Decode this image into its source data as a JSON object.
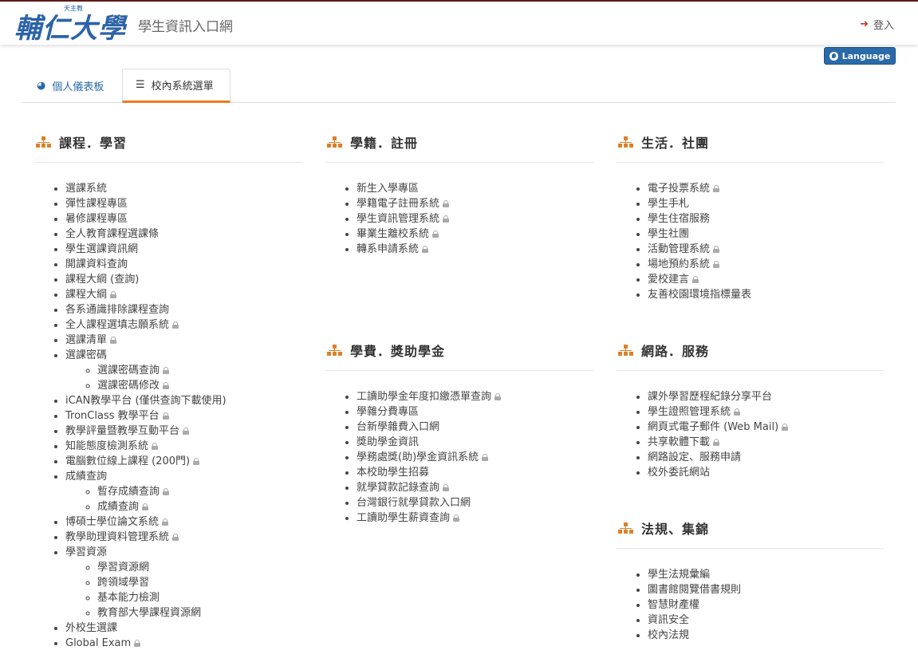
{
  "header": {
    "logo_text": "輔仁大學",
    "logo_small": "天主教",
    "site_title": "學生資訊入口網",
    "login_label": "登入",
    "language_label": "Language"
  },
  "tabs": [
    {
      "label": "個人儀表板",
      "icon": "dashboard-icon",
      "active": false
    },
    {
      "label": "校內系統選單",
      "icon": "list-icon",
      "active": true
    }
  ],
  "colors": {
    "accent": "#2a6aa8",
    "section_icon": "#d9822b",
    "active_tab_border": "#e67e22",
    "lock": "#aaaaaa"
  },
  "sections": {
    "course": {
      "title": "課程．學習",
      "items": [
        {
          "label": "選課系統",
          "lock": false
        },
        {
          "label": "彈性課程專區",
          "lock": false
        },
        {
          "label": "暑修課程專區",
          "lock": false
        },
        {
          "label": "全人教育課程選課條",
          "lock": false
        },
        {
          "label": "學生選課資訊網",
          "lock": false
        },
        {
          "label": "開課資料查詢",
          "lock": false
        },
        {
          "label": "課程大綱 (查詢)",
          "lock": false
        },
        {
          "label": "課程大綱",
          "lock": true
        },
        {
          "label": "各系通識排除課程查詢",
          "lock": false
        },
        {
          "label": "全人課程選填志願系統",
          "lock": true
        },
        {
          "label": "選課清單",
          "lock": true
        },
        {
          "label": "選課密碼",
          "lock": false,
          "children": [
            {
              "label": "選課密碼查詢",
              "lock": true
            },
            {
              "label": "選課密碼修改",
              "lock": true
            }
          ]
        },
        {
          "label": "iCAN教學平台 (僅供查詢下載使用)",
          "lock": false
        },
        {
          "label": "TronClass 教學平台",
          "lock": true
        },
        {
          "label": "教學評量暨教學互動平台",
          "lock": true
        },
        {
          "label": "知能態度檢測系統",
          "lock": true
        },
        {
          "label": "電腦數位線上課程 (200門)",
          "lock": true
        },
        {
          "label": "成績查詢",
          "lock": false,
          "children": [
            {
              "label": "暫存成績查詢",
              "lock": true
            },
            {
              "label": "成績查詢",
              "lock": true
            }
          ]
        },
        {
          "label": "博碩士學位論文系統",
          "lock": true
        },
        {
          "label": "教學助理資料管理系統",
          "lock": true
        },
        {
          "label": "學習資源",
          "lock": false,
          "children": [
            {
              "label": "學習資源網",
              "lock": false
            },
            {
              "label": "跨領域學習",
              "lock": false
            },
            {
              "label": "基本能力檢測",
              "lock": false
            },
            {
              "label": "教育部大學課程資源網",
              "lock": false
            }
          ]
        },
        {
          "label": "外校生選課",
          "lock": false
        },
        {
          "label": "Global Exam",
          "lock": true
        }
      ]
    },
    "registry": {
      "title": "學籍．註冊",
      "items": [
        {
          "label": "新生入學專區",
          "lock": false
        },
        {
          "label": "學籍電子註冊系統",
          "lock": true
        },
        {
          "label": "學生資訊管理系統",
          "lock": true
        },
        {
          "label": "畢業生離校系統",
          "lock": true
        },
        {
          "label": "轉系申請系統",
          "lock": true
        }
      ]
    },
    "tuition": {
      "title": "學費．獎助學金",
      "items": [
        {
          "label": "工讀助學金年度扣繳憑單查詢",
          "lock": true
        },
        {
          "label": "學雜分費專區",
          "lock": false
        },
        {
          "label": "台新學雜費入口網",
          "lock": false
        },
        {
          "label": "獎助學金資訊",
          "lock": false
        },
        {
          "label": "學務處獎(助)學金資訊系統",
          "lock": true
        },
        {
          "label": "本校助學生招募",
          "lock": false
        },
        {
          "label": "就學貸款記錄查詢",
          "lock": true
        },
        {
          "label": "台灣銀行就學貸款入口網",
          "lock": false
        },
        {
          "label": "工讀助學生薪資查詢",
          "lock": true
        }
      ]
    },
    "life": {
      "title": "生活．社團",
      "items": [
        {
          "label": "電子投票系統",
          "lock": true
        },
        {
          "label": "學生手札",
          "lock": false
        },
        {
          "label": "學生住宿服務",
          "lock": false
        },
        {
          "label": "學生社團",
          "lock": false
        },
        {
          "label": "活動管理系統",
          "lock": true
        },
        {
          "label": "場地預約系統",
          "lock": true
        },
        {
          "label": "愛校建言",
          "lock": true
        },
        {
          "label": "友善校園環境指標量表",
          "lock": false
        }
      ]
    },
    "network": {
      "title": "網路．服務",
      "items": [
        {
          "label": "課外學習歷程紀錄分享平台",
          "lock": false
        },
        {
          "label": "學生證照管理系統",
          "lock": true
        },
        {
          "label": "網頁式電子郵件 (Web Mail)",
          "lock": true
        },
        {
          "label": "共享軟體下載",
          "lock": true
        },
        {
          "label": "網路設定、服務申請",
          "lock": false
        },
        {
          "label": "校外委託網站",
          "lock": false
        }
      ]
    },
    "rules": {
      "title": "法規、集錦",
      "items": [
        {
          "label": "學生法規彙編",
          "lock": false
        },
        {
          "label": "圖書館閱覽借書規則",
          "lock": false
        },
        {
          "label": "智慧財產權",
          "lock": false
        },
        {
          "label": "資訊安全",
          "lock": false
        },
        {
          "label": "校內法規",
          "lock": false
        }
      ]
    }
  }
}
